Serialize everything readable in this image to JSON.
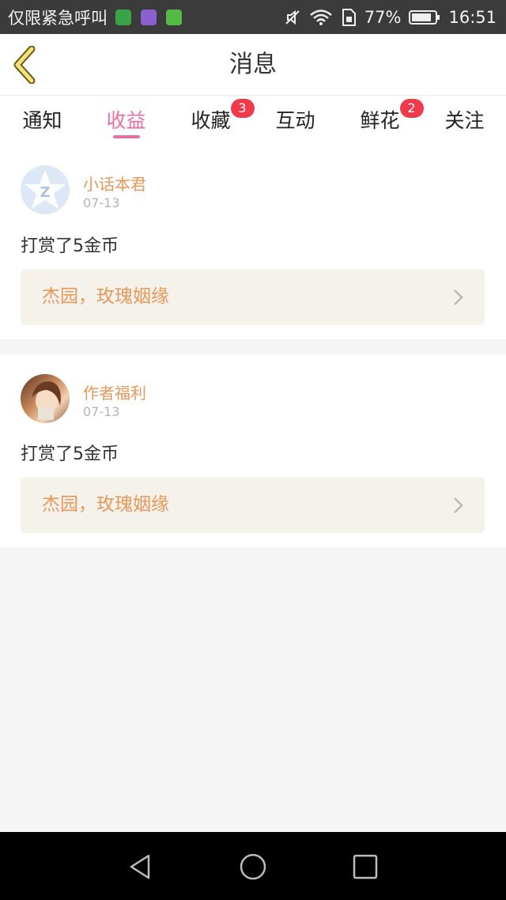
{
  "status_bar": {
    "carrier": "仅限紧急呼叫",
    "battery": "77%",
    "time": "16:51",
    "icons": [
      "app-notify-green-icon",
      "app-notify-purple-icon",
      "app-notify-green2-icon",
      "mute-icon",
      "wifi-icon",
      "sim-icon",
      "battery-icon"
    ]
  },
  "header": {
    "title": "消息",
    "back_icon": "chevron-left-icon"
  },
  "tabs": [
    {
      "label": "通知",
      "badge": ""
    },
    {
      "label": "收益",
      "badge": "",
      "active": true
    },
    {
      "label": "收藏",
      "badge": "3"
    },
    {
      "label": "互动",
      "badge": ""
    },
    {
      "label": "鲜花",
      "badge": "2"
    },
    {
      "label": "关注",
      "badge": ""
    }
  ],
  "messages": [
    {
      "author": "小话本君",
      "date": "07-13",
      "action": "打赏了5金币",
      "book": "杰园，玫瑰姻缘",
      "avatar": "qq-default-avatar-icon"
    },
    {
      "author": "作者福利",
      "date": "07-13",
      "action": "打赏了5金币",
      "book": "杰园，玫瑰姻缘",
      "avatar": "anime-girl-avatar"
    }
  ],
  "colors": {
    "accent": "#e86ea3",
    "author": "#e8985a",
    "badge": "#f0394a",
    "book_bg": "#f4f2ea"
  },
  "nav": [
    "back-triangle-icon",
    "home-circle-icon",
    "recents-square-icon"
  ]
}
